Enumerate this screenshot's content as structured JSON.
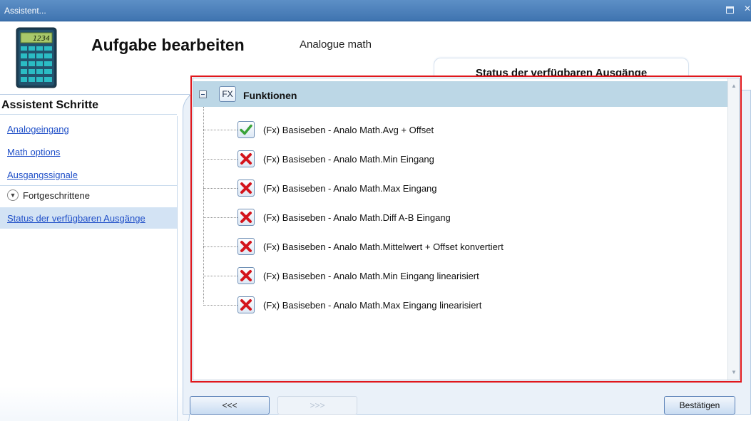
{
  "window": {
    "title": "Assistent..."
  },
  "header": {
    "title": "Aufgabe bearbeiten",
    "subtitle": "Analogue math",
    "calculator_display": "1234",
    "step_tab": "Status der verfügbaren Ausgänge"
  },
  "sidebar": {
    "heading": "Assistent Schritte",
    "links": [
      {
        "label": "Analogeingang"
      },
      {
        "label": "Math options"
      },
      {
        "label": "Ausgangssignale"
      }
    ],
    "group": {
      "label": "Fortgeschrittene",
      "icon": "chevron-down-icon"
    },
    "active": {
      "label": "Status der verfügbaren Ausgänge"
    }
  },
  "tree": {
    "root": {
      "icon_text": "FX",
      "label": "Funktionen"
    },
    "items": [
      {
        "label": "(Fx) Basiseben - Analo Math.Avg + Offset",
        "status": "ok"
      },
      {
        "label": "(Fx) Basiseben - Analo Math.Min Eingang",
        "status": "error"
      },
      {
        "label": "(Fx) Basiseben - Analo Math.Max Eingang",
        "status": "error"
      },
      {
        "label": "(Fx) Basiseben - Analo Math.Diff A-B Eingang",
        "status": "error"
      },
      {
        "label": "(Fx) Basiseben - Analo Math.Mittelwert + Offset konvertiert",
        "status": "error"
      },
      {
        "label": "(Fx) Basiseben - Analo Math.Min Eingang linearisiert",
        "status": "error"
      },
      {
        "label": "(Fx) Basiseben - Analo Math.Max Eingang linearisiert",
        "status": "error"
      }
    ]
  },
  "footer": {
    "back_label": "<<<",
    "next_label": ">>>",
    "confirm_label": "Bestätigen"
  },
  "colors": {
    "highlight_border": "#e0171c",
    "link": "#1f4fc8",
    "tree_header": "#bcd7e6",
    "ok": "#3aa33a",
    "error": "#d4141c"
  }
}
